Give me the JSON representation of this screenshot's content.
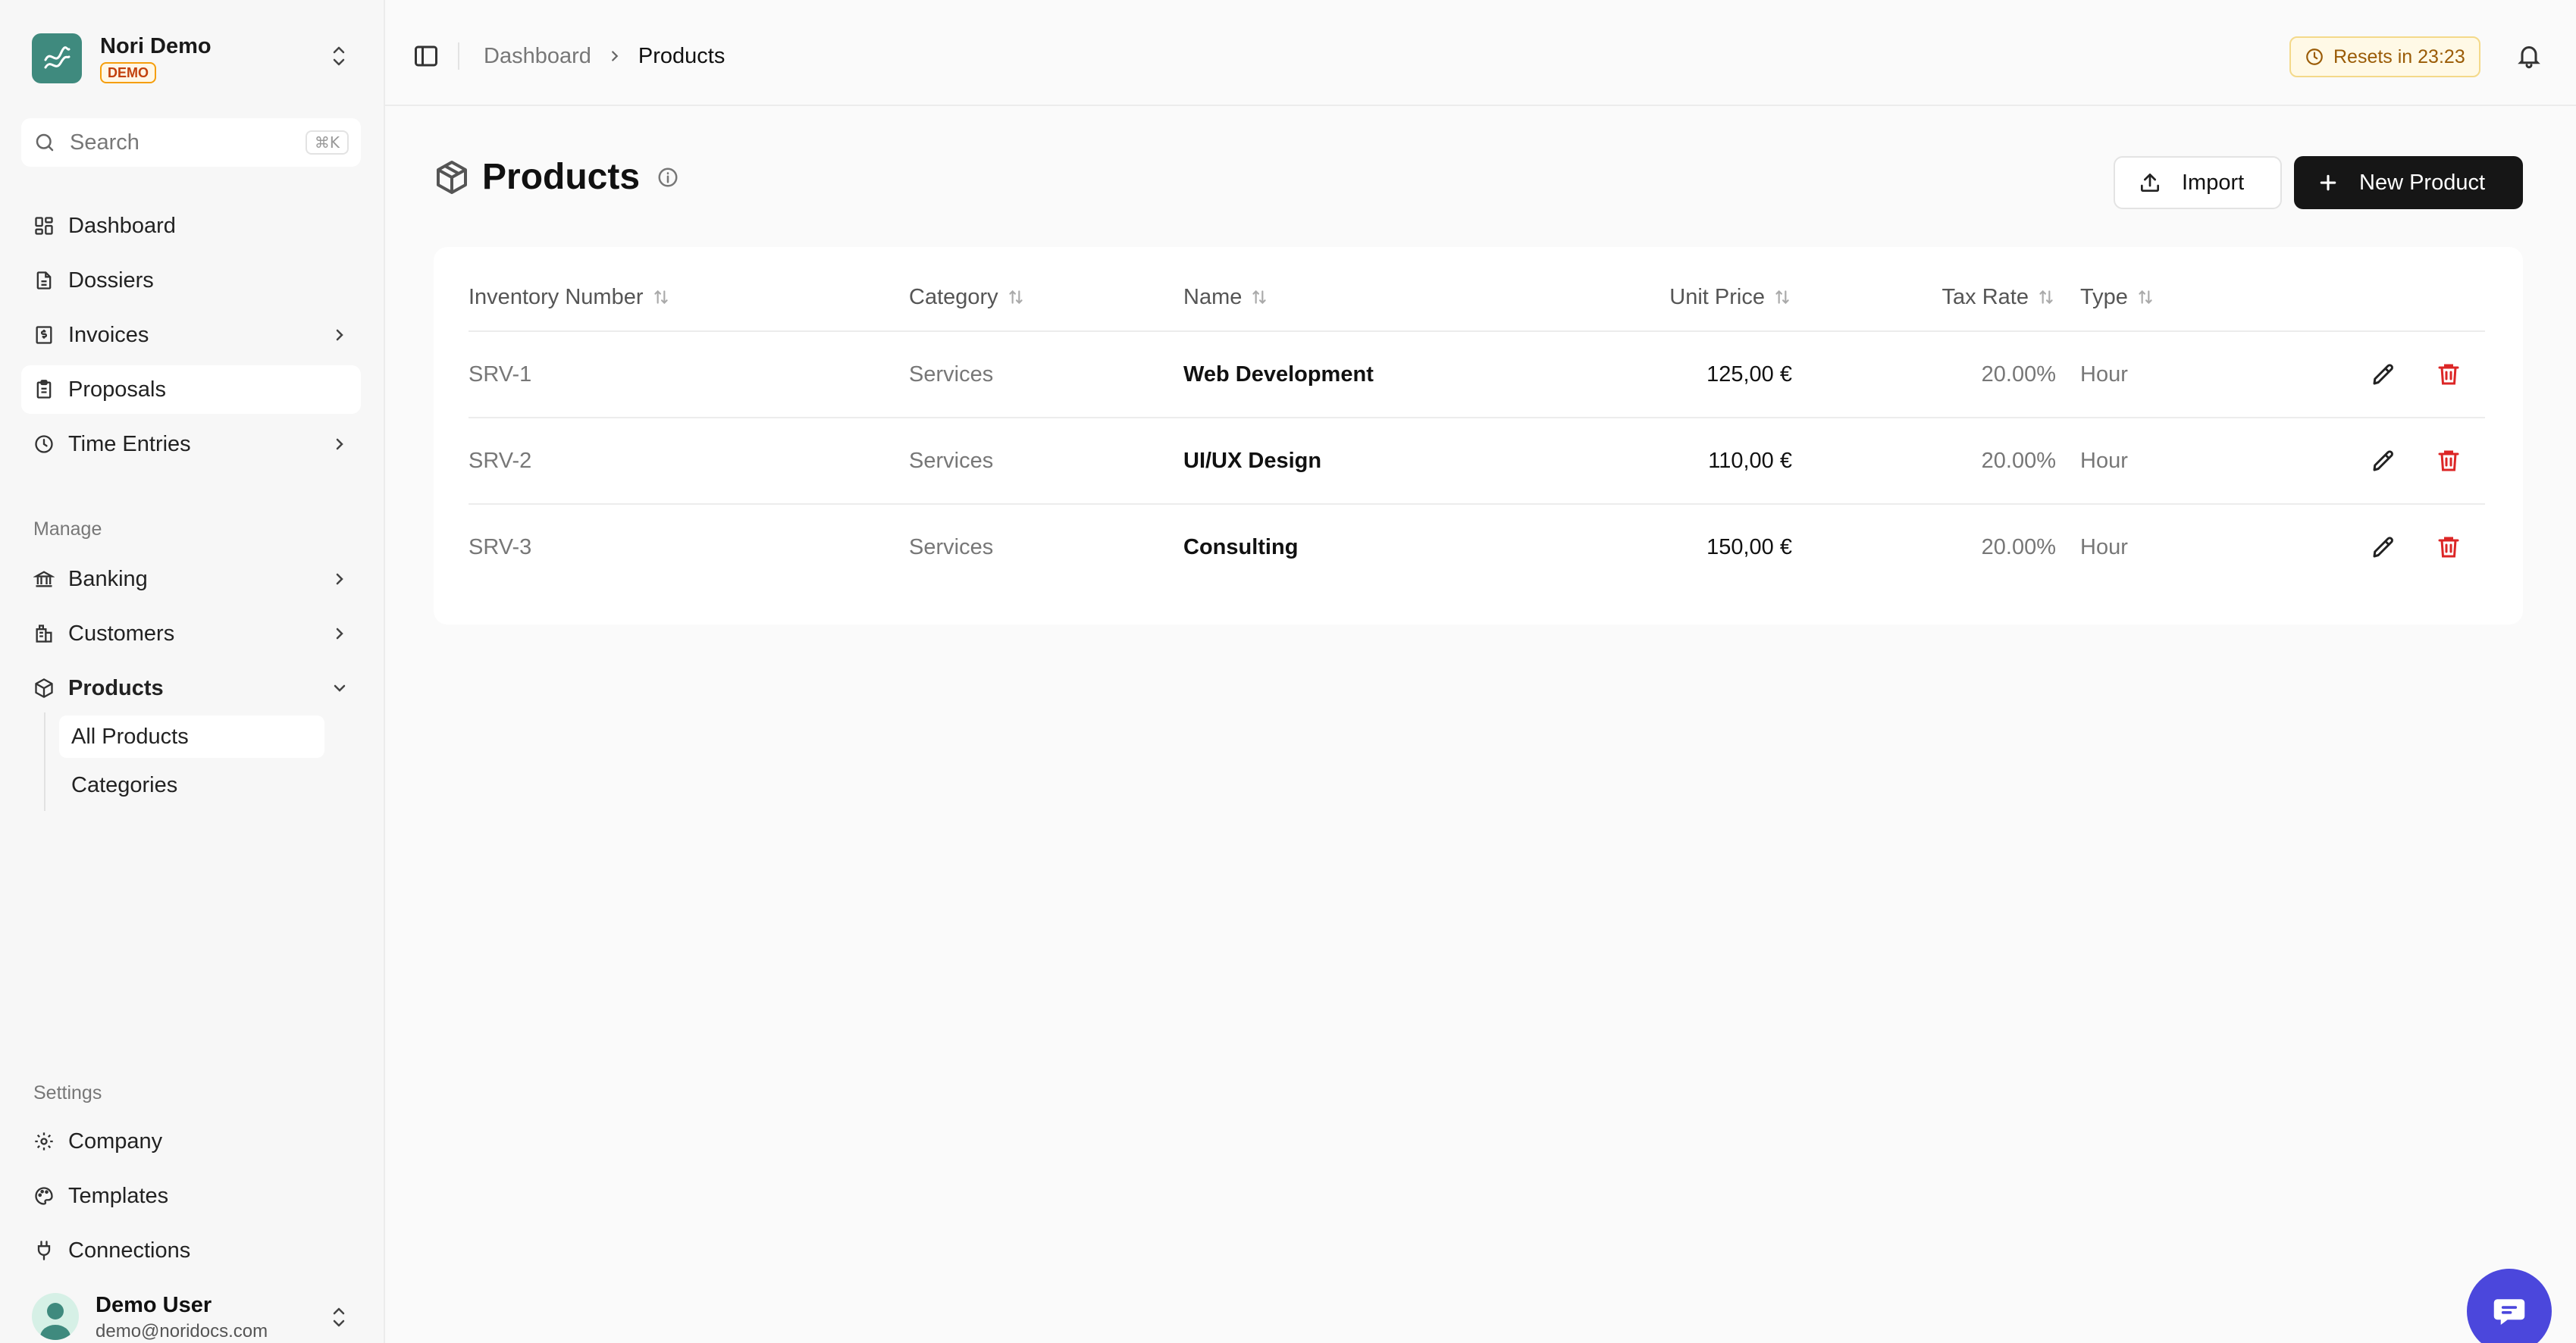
{
  "brand": {
    "name": "Nori Demo",
    "badge": "DEMO"
  },
  "search": {
    "placeholder": "Search",
    "shortcut": "⌘K"
  },
  "nav": {
    "dashboard": "Dashboard",
    "dossiers": "Dossiers",
    "invoices": "Invoices",
    "proposals": "Proposals",
    "time_entries": "Time Entries",
    "manage_title": "Manage",
    "banking": "Banking",
    "customers": "Customers",
    "products": "Products",
    "products_sub": {
      "all_products": "All Products",
      "categories": "Categories"
    },
    "settings_title": "Settings",
    "company": "Company",
    "templates": "Templates",
    "connections": "Connections"
  },
  "user": {
    "name": "Demo User",
    "email": "demo@noridocs.com"
  },
  "breadcrumb": {
    "parent": "Dashboard",
    "current": "Products"
  },
  "reset_timer": "Resets in 23:23",
  "page": {
    "title": "Products",
    "import_label": "Import",
    "new_label": "New Product"
  },
  "table": {
    "headers": {
      "inventory": "Inventory Number",
      "category": "Category",
      "name": "Name",
      "unit_price": "Unit Price",
      "tax_rate": "Tax Rate",
      "type": "Type"
    },
    "rows": [
      {
        "inventory": "SRV-1",
        "category": "Services",
        "name": "Web Development",
        "unit_price": "125,00 €",
        "tax_rate": "20.00%",
        "type": "Hour"
      },
      {
        "inventory": "SRV-2",
        "category": "Services",
        "name": "UI/UX Design",
        "unit_price": "110,00 €",
        "tax_rate": "20.00%",
        "type": "Hour"
      },
      {
        "inventory": "SRV-3",
        "category": "Services",
        "name": "Consulting",
        "unit_price": "150,00 €",
        "tax_rate": "20.00%",
        "type": "Hour"
      }
    ]
  },
  "colors": {
    "accent_dark": "#161616",
    "delete_red": "#dc2626",
    "chat_purple": "#4b47dc",
    "brand_teal": "#3f8a7e",
    "demo_badge": "#f59e0b"
  }
}
